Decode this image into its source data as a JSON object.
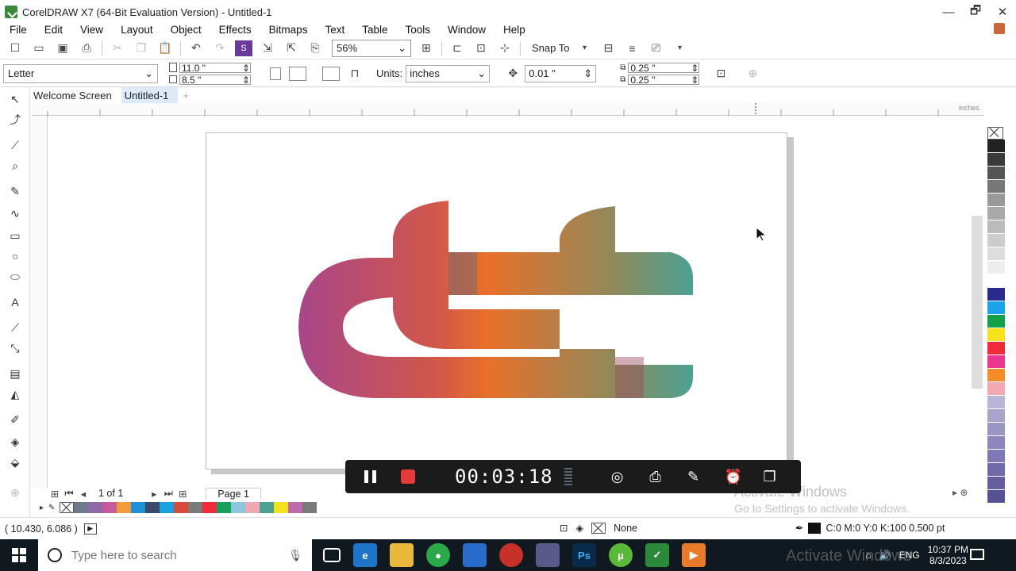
{
  "window": {
    "title": "CorelDRAW X7 (64-Bit Evaluation Version) - Untitled-1",
    "controls": [
      "—",
      "🗗",
      "✕"
    ]
  },
  "menu": {
    "items": [
      "File",
      "Edit",
      "View",
      "Layout",
      "Object",
      "Effects",
      "Bitmaps",
      "Text",
      "Table",
      "Tools",
      "Window",
      "Help"
    ]
  },
  "standard_toolbar": {
    "zoom_value": "56%",
    "snap_to_label": "Snap To"
  },
  "property_bar": {
    "paper_size": "Letter",
    "width": "11.0 \"",
    "height": "8.5 \"",
    "units_label": "Units:",
    "units_value": "inches",
    "nudge_value": "0.01 \"",
    "dup_x": "0.25 \"",
    "dup_y": "0.25 \""
  },
  "doc_tabs": [
    {
      "label": "Welcome Screen"
    },
    {
      "label": "Untitled-1"
    }
  ],
  "ruler": {
    "unit_label": "inches"
  },
  "page_nav": {
    "count": "1 of 1",
    "page_name": "Page 1"
  },
  "logo": {
    "gradient_colors": [
      "#a8468a",
      "#d1574a",
      "#e8702a",
      "#8f8a5c",
      "#4aa294"
    ]
  },
  "color_palette": [
    "#222222",
    "#3a3a3a",
    "#555555",
    "#777777",
    "#999999",
    "#aaaaaa",
    "#bbbbbb",
    "#cccccc",
    "#dddddd",
    "#eeeeee",
    "#ffffff",
    "#2b2a8e",
    "#1aa3e8",
    "#14a04a",
    "#f5e21a",
    "#f02a3a",
    "#e8378c",
    "#f48c2a",
    "#f2a8b0",
    "#b9b5d8",
    "#a8a4cc",
    "#9a96c4",
    "#8b86bb",
    "#7e79b2",
    "#706ba8",
    "#645e9e",
    "#575294"
  ],
  "document_palette": [
    "#6d7a8e",
    "#8c6aa6",
    "#c45a9c",
    "#f39a3a",
    "#1e90d8",
    "#3a4a6a",
    "#16a3e0",
    "#d84a3a",
    "#7a7a7a",
    "#f02a3a",
    "#16a05a",
    "#8ac8e0",
    "#f2a8b0",
    "#4aa294",
    "#f5e21a",
    "#c06ab0",
    "#7a7a7a"
  ],
  "status": {
    "coords": "( 10.430, 6.086 )",
    "fill_label": "None",
    "outline_label": "C:0 M:0 Y:0 K:100  0.500 pt"
  },
  "recorder": {
    "time": "00:03:18"
  },
  "watermark": {
    "line1": "Activate Windows",
    "line2": "Go to Settings to activate Windows."
  },
  "taskbar": {
    "search_placeholder": "Type here to search",
    "lang": "ENG",
    "time": "10:37 PM",
    "date": "8/3/2023",
    "watermark": "Activate Windows"
  }
}
